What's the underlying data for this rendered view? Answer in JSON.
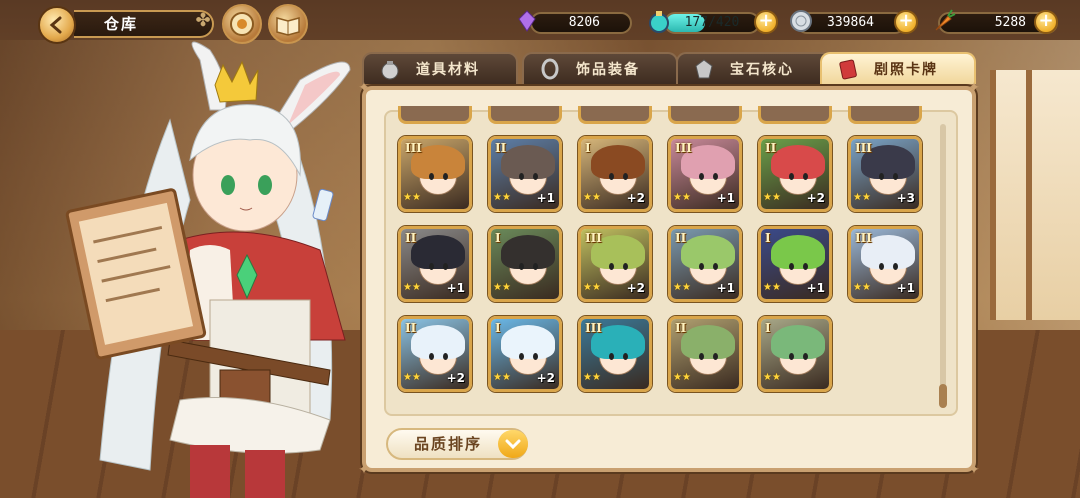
{
  "header": {
    "title": "仓库"
  },
  "currencies": {
    "gem": {
      "value": "8206",
      "icon": "purple-crystal-icon"
    },
    "stamina": {
      "value": "177/420",
      "fraction": 0.42,
      "icon": "potion-icon"
    },
    "coin": {
      "value": "339864",
      "icon": "silver-coin-icon"
    },
    "carrot": {
      "value": "5288",
      "icon": "carrot-icon"
    }
  },
  "tabs": [
    {
      "label": "道具材料",
      "icon": "pouch-icon",
      "active": false
    },
    {
      "label": "饰品装备",
      "icon": "ring-icon",
      "active": false
    },
    {
      "label": "宝石核心",
      "icon": "gem-core-icon",
      "active": false
    },
    {
      "label": "剧照卡牌",
      "icon": "card-icon",
      "active": true
    }
  ],
  "cards": [
    {
      "rank": "III",
      "stars": "★★",
      "count": "",
      "hair": "#c9843a",
      "bg": "#c9a66a"
    },
    {
      "rank": "II",
      "stars": "★★",
      "count": "+1",
      "hair": "#6a5a52",
      "bg": "#5d7fa8"
    },
    {
      "rank": "I",
      "stars": "★★",
      "count": "+2",
      "hair": "#8a4a22",
      "bg": "#d6b67a"
    },
    {
      "rank": "III",
      "stars": "★★",
      "count": "+1",
      "hair": "#e0a0b0",
      "bg": "#c98a9a"
    },
    {
      "rank": "II",
      "stars": "★★",
      "count": "+2",
      "hair": "#d84a4a",
      "bg": "#6aa04a"
    },
    {
      "rank": "III",
      "stars": "★★",
      "count": "+3",
      "hair": "#3a3a4a",
      "bg": "#7aa4c8"
    },
    {
      "rank": "II",
      "stars": "★★",
      "count": "+1",
      "hair": "#2a2a34",
      "bg": "#8a8a8a"
    },
    {
      "rank": "I",
      "stars": "★★",
      "count": "",
      "hair": "#34302e",
      "bg": "#6a8a5a"
    },
    {
      "rank": "III",
      "stars": "★★",
      "count": "+2",
      "hair": "#a8c05a",
      "bg": "#c0c060"
    },
    {
      "rank": "II",
      "stars": "★★",
      "count": "+1",
      "hair": "#9ac86a",
      "bg": "#7a9ab0"
    },
    {
      "rank": "I",
      "stars": "★★",
      "count": "+1",
      "hair": "#7ac84a",
      "bg": "#3a4a8a"
    },
    {
      "rank": "III",
      "stars": "★★",
      "count": "+1",
      "hair": "#e8eef6",
      "bg": "#9ab8d8"
    },
    {
      "rank": "II",
      "stars": "★★",
      "count": "+2",
      "hair": "#e8f2fa",
      "bg": "#8ac4e6"
    },
    {
      "rank": "I",
      "stars": "★★",
      "count": "+2",
      "hair": "#eaf4fc",
      "bg": "#6ab8e8"
    },
    {
      "rank": "III",
      "stars": "★★",
      "count": "",
      "hair": "#2ab0b8",
      "bg": "#3a7a9a"
    },
    {
      "rank": "II",
      "stars": "★★",
      "count": "",
      "hair": "#8ab06a",
      "bg": "#b0a070"
    },
    {
      "rank": "I",
      "stars": "★★",
      "count": "",
      "hair": "#7ab87a",
      "bg": "#a8a888"
    }
  ],
  "sort": {
    "label": "品质排序"
  },
  "colors": {
    "panel": "#f7ecd6",
    "frame_gold": "#d9a54a",
    "accent_yellow": "#f0b02a",
    "stamina": "#2cb8b0"
  }
}
